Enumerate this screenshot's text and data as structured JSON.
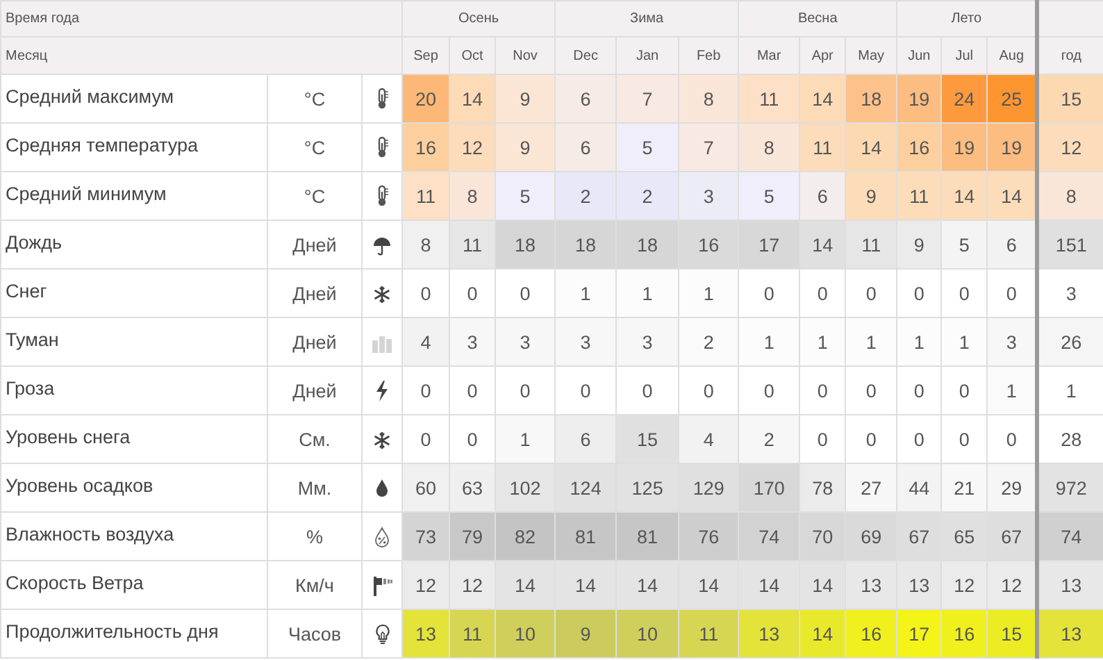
{
  "header": {
    "season_label": "Время года",
    "month_label": "Месяц",
    "seasons": [
      "Осень",
      "Зима",
      "Весна",
      "Лето"
    ],
    "months": [
      "Sep",
      "Oct",
      "Nov",
      "Dec",
      "Jan",
      "Feb",
      "Mar",
      "Apr",
      "May",
      "Jun",
      "Jul",
      "Aug"
    ],
    "year_label": "год"
  },
  "rows": [
    {
      "label": "Средний максимум",
      "unit": "°C",
      "kind": "thermometer",
      "cells": [
        {
          "value": "20",
          "color": "#fdb877"
        },
        {
          "value": "14",
          "color": "#fddbb6"
        },
        {
          "value": "9",
          "color": "#fbe6d6"
        },
        {
          "value": "6",
          "color": "#f6ebe6"
        },
        {
          "value": "7",
          "color": "#f8e9e2"
        },
        {
          "value": "8",
          "color": "#fae6d8"
        },
        {
          "value": "11",
          "color": "#fde0c6"
        },
        {
          "value": "14",
          "color": "#fddbb6"
        },
        {
          "value": "18",
          "color": "#fdc28a"
        },
        {
          "value": "19",
          "color": "#fdbc80"
        },
        {
          "value": "24",
          "color": "#fd9a3e"
        },
        {
          "value": "25",
          "color": "#fd9530"
        }
      ],
      "year": {
        "value": "15",
        "color": "#fdd9b2"
      }
    },
    {
      "label": "Средняя температура",
      "unit": "°C",
      "kind": "thermometer",
      "cells": [
        {
          "value": "16",
          "color": "#fdcf9e"
        },
        {
          "value": "12",
          "color": "#fddcbb"
        },
        {
          "value": "9",
          "color": "#fbe6d6"
        },
        {
          "value": "6",
          "color": "#f6ebe6"
        },
        {
          "value": "5",
          "color": "#f0eefa"
        },
        {
          "value": "7",
          "color": "#f8e9e2"
        },
        {
          "value": "8",
          "color": "#fae6d8"
        },
        {
          "value": "11",
          "color": "#fddcbb"
        },
        {
          "value": "14",
          "color": "#fdd9b2"
        },
        {
          "value": "16",
          "color": "#fdcf9e"
        },
        {
          "value": "19",
          "color": "#fdbc80"
        },
        {
          "value": "19",
          "color": "#fdbc80"
        }
      ],
      "year": {
        "value": "12",
        "color": "#fddcbb"
      }
    },
    {
      "label": "Средний минимум",
      "unit": "°C",
      "kind": "thermometer",
      "cells": [
        {
          "value": "11",
          "color": "#fde0c6"
        },
        {
          "value": "8",
          "color": "#fae6d8"
        },
        {
          "value": "5",
          "color": "#f0eefa"
        },
        {
          "value": "2",
          "color": "#e8e8f8"
        },
        {
          "value": "2",
          "color": "#e8e8f8"
        },
        {
          "value": "3",
          "color": "#ececf7"
        },
        {
          "value": "5",
          "color": "#f0eefa"
        },
        {
          "value": "6",
          "color": "#f4edee"
        },
        {
          "value": "9",
          "color": "#fddcb9"
        },
        {
          "value": "11",
          "color": "#fddcb9"
        },
        {
          "value": "14",
          "color": "#fddcb9"
        },
        {
          "value": "14",
          "color": "#fddcb9"
        }
      ],
      "year": {
        "value": "8",
        "color": "#fae6d8"
      }
    },
    {
      "label": "Дождь",
      "unit": "Дней",
      "kind": "umbrella",
      "cells": [
        {
          "value": "8",
          "color": "#f0f0f0"
        },
        {
          "value": "11",
          "color": "#e6e6e6"
        },
        {
          "value": "18",
          "color": "#d6d6d6"
        },
        {
          "value": "18",
          "color": "#d6d6d6"
        },
        {
          "value": "18",
          "color": "#d6d6d6"
        },
        {
          "value": "16",
          "color": "#dadada"
        },
        {
          "value": "17",
          "color": "#d8d8d8"
        },
        {
          "value": "14",
          "color": "#e0e0e0"
        },
        {
          "value": "11",
          "color": "#e6e6e6"
        },
        {
          "value": "9",
          "color": "#ebebeb"
        },
        {
          "value": "5",
          "color": "#f4f4f4"
        },
        {
          "value": "6",
          "color": "#f2f2f2"
        }
      ],
      "year": {
        "value": "151",
        "color": "#e0e0e0"
      }
    },
    {
      "label": "Снег",
      "unit": "Дней",
      "kind": "snowflake",
      "cells": [
        {
          "value": "0",
          "color": "#ffffff"
        },
        {
          "value": "0",
          "color": "#ffffff"
        },
        {
          "value": "0",
          "color": "#ffffff"
        },
        {
          "value": "1",
          "color": "#fcfcfc"
        },
        {
          "value": "1",
          "color": "#fcfcfc"
        },
        {
          "value": "1",
          "color": "#fcfcfc"
        },
        {
          "value": "0",
          "color": "#ffffff"
        },
        {
          "value": "0",
          "color": "#ffffff"
        },
        {
          "value": "0",
          "color": "#ffffff"
        },
        {
          "value": "0",
          "color": "#ffffff"
        },
        {
          "value": "0",
          "color": "#ffffff"
        },
        {
          "value": "0",
          "color": "#ffffff"
        }
      ],
      "year": {
        "value": "3",
        "color": "#ffffff"
      }
    },
    {
      "label": "Туман",
      "unit": "Дней",
      "kind": "buildings",
      "cells": [
        {
          "value": "4",
          "color": "#f2f2f2"
        },
        {
          "value": "3",
          "color": "#f7f7f7"
        },
        {
          "value": "3",
          "color": "#f7f7f7"
        },
        {
          "value": "3",
          "color": "#f7f7f7"
        },
        {
          "value": "3",
          "color": "#f7f7f7"
        },
        {
          "value": "2",
          "color": "#fafafa"
        },
        {
          "value": "1",
          "color": "#fcfcfc"
        },
        {
          "value": "1",
          "color": "#fcfcfc"
        },
        {
          "value": "1",
          "color": "#fcfcfc"
        },
        {
          "value": "1",
          "color": "#fcfcfc"
        },
        {
          "value": "1",
          "color": "#fcfcfc"
        },
        {
          "value": "3",
          "color": "#f7f7f7"
        }
      ],
      "year": {
        "value": "26",
        "color": "#f5f5f5"
      }
    },
    {
      "label": "Гроза",
      "unit": "Дней",
      "kind": "lightning",
      "cells": [
        {
          "value": "0",
          "color": "#ffffff"
        },
        {
          "value": "0",
          "color": "#ffffff"
        },
        {
          "value": "0",
          "color": "#ffffff"
        },
        {
          "value": "0",
          "color": "#ffffff"
        },
        {
          "value": "0",
          "color": "#ffffff"
        },
        {
          "value": "0",
          "color": "#ffffff"
        },
        {
          "value": "0",
          "color": "#ffffff"
        },
        {
          "value": "0",
          "color": "#ffffff"
        },
        {
          "value": "0",
          "color": "#ffffff"
        },
        {
          "value": "0",
          "color": "#ffffff"
        },
        {
          "value": "0",
          "color": "#ffffff"
        },
        {
          "value": "1",
          "color": "#fafafa"
        }
      ],
      "year": {
        "value": "1",
        "color": "#ffffff"
      }
    },
    {
      "label": "Уровень снега",
      "unit": "См.",
      "kind": "snowflake",
      "cells": [
        {
          "value": "0",
          "color": "#ffffff"
        },
        {
          "value": "0",
          "color": "#ffffff"
        },
        {
          "value": "1",
          "color": "#f8f8f8"
        },
        {
          "value": "6",
          "color": "#eeeeee"
        },
        {
          "value": "15",
          "color": "#e0e0e0"
        },
        {
          "value": "4",
          "color": "#f2f2f2"
        },
        {
          "value": "2",
          "color": "#f7f7f7"
        },
        {
          "value": "0",
          "color": "#ffffff"
        },
        {
          "value": "0",
          "color": "#ffffff"
        },
        {
          "value": "0",
          "color": "#ffffff"
        },
        {
          "value": "0",
          "color": "#ffffff"
        },
        {
          "value": "0",
          "color": "#ffffff"
        }
      ],
      "year": {
        "value": "28",
        "color": "#ffffff"
      }
    },
    {
      "label": "Уровень осадков",
      "unit": "Мм.",
      "kind": "drop",
      "cells": [
        {
          "value": "60",
          "color": "#f0f0f0"
        },
        {
          "value": "63",
          "color": "#efefef"
        },
        {
          "value": "102",
          "color": "#e6e6e6"
        },
        {
          "value": "124",
          "color": "#e2e2e2"
        },
        {
          "value": "125",
          "color": "#e2e2e2"
        },
        {
          "value": "129",
          "color": "#e0e0e0"
        },
        {
          "value": "170",
          "color": "#d8d8d8"
        },
        {
          "value": "78",
          "color": "#ebebeb"
        },
        {
          "value": "27",
          "color": "#f7f7f7"
        },
        {
          "value": "44",
          "color": "#f3f3f3"
        },
        {
          "value": "21",
          "color": "#f8f8f8"
        },
        {
          "value": "29",
          "color": "#f6f6f6"
        }
      ],
      "year": {
        "value": "972",
        "color": "#e3e3e3"
      }
    },
    {
      "label": "Влажность воздуха",
      "unit": "%",
      "kind": "humidity",
      "cells": [
        {
          "value": "73",
          "color": "#d4d4d4"
        },
        {
          "value": "79",
          "color": "#c8c8c8"
        },
        {
          "value": "82",
          "color": "#c4c4c4"
        },
        {
          "value": "81",
          "color": "#c6c6c6"
        },
        {
          "value": "81",
          "color": "#c6c6c6"
        },
        {
          "value": "76",
          "color": "#cecece"
        },
        {
          "value": "74",
          "color": "#d2d2d2"
        },
        {
          "value": "70",
          "color": "#d8d8d8"
        },
        {
          "value": "69",
          "color": "#dadada"
        },
        {
          "value": "67",
          "color": "#dedede"
        },
        {
          "value": "65",
          "color": "#e0e0e0"
        },
        {
          "value": "67",
          "color": "#dedede"
        }
      ],
      "year": {
        "value": "74",
        "color": "#d0d0d0"
      }
    },
    {
      "label": "Скорость Ветра",
      "unit": "Км/ч",
      "kind": "wind",
      "cells": [
        {
          "value": "12",
          "color": "#ebebeb"
        },
        {
          "value": "12",
          "color": "#ebebeb"
        },
        {
          "value": "14",
          "color": "#e4e4e4"
        },
        {
          "value": "14",
          "color": "#e4e4e4"
        },
        {
          "value": "14",
          "color": "#e4e4e4"
        },
        {
          "value": "14",
          "color": "#e4e4e4"
        },
        {
          "value": "14",
          "color": "#e4e4e4"
        },
        {
          "value": "14",
          "color": "#e4e4e4"
        },
        {
          "value": "13",
          "color": "#e8e8e8"
        },
        {
          "value": "13",
          "color": "#e8e8e8"
        },
        {
          "value": "12",
          "color": "#ebebeb"
        },
        {
          "value": "12",
          "color": "#ebebeb"
        }
      ],
      "year": {
        "value": "13",
        "color": "#e8e8e8"
      }
    },
    {
      "label": "Продолжительность дня",
      "unit": "Часов",
      "kind": "bulb",
      "cells": [
        {
          "value": "13",
          "color": "#e3e33a"
        },
        {
          "value": "11",
          "color": "#d6d653"
        },
        {
          "value": "10",
          "color": "#cfcf5c"
        },
        {
          "value": "9",
          "color": "#cccc5e"
        },
        {
          "value": "10",
          "color": "#cfcf5c"
        },
        {
          "value": "11",
          "color": "#d6d653"
        },
        {
          "value": "13",
          "color": "#e3e33a"
        },
        {
          "value": "14",
          "color": "#e9e92c"
        },
        {
          "value": "16",
          "color": "#f0f01e"
        },
        {
          "value": "17",
          "color": "#f4f419"
        },
        {
          "value": "16",
          "color": "#f0f01e"
        },
        {
          "value": "15",
          "color": "#ecec25"
        }
      ],
      "year": {
        "value": "13",
        "color": "#e3e33a"
      }
    }
  ]
}
